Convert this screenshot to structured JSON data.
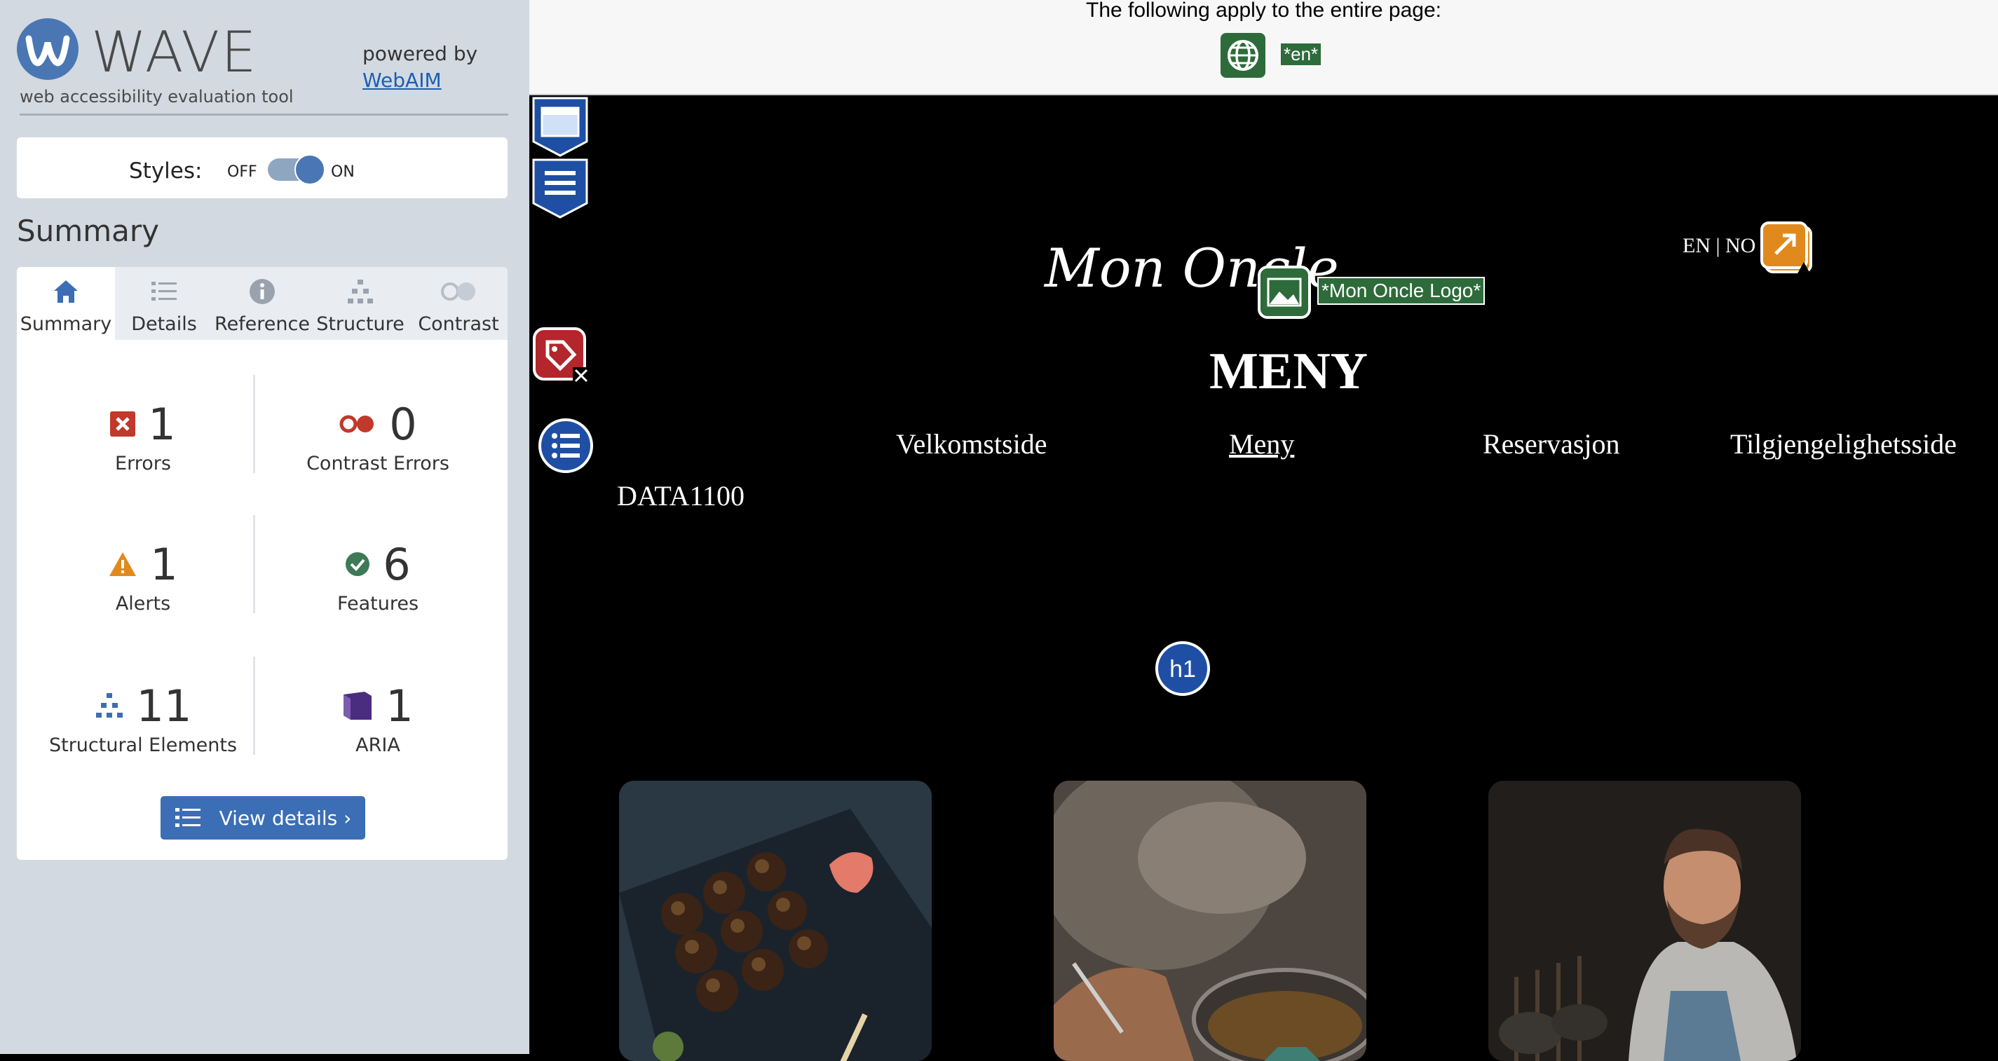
{
  "wave": {
    "logo_text": "WAVE",
    "logo_sub": "web accessibility evaluation tool",
    "powered_by": "powered by",
    "webaim_link": "WebAIM",
    "styles_label": "Styles:",
    "styles_off": "OFF",
    "styles_on": "ON",
    "summary_heading": "Summary",
    "tabs": [
      {
        "label": "Summary",
        "icon": "home-icon"
      },
      {
        "label": "Details",
        "icon": "list-icon"
      },
      {
        "label": "Reference",
        "icon": "info-icon"
      },
      {
        "label": "Structure",
        "icon": "hierarchy-icon"
      },
      {
        "label": "Contrast",
        "icon": "contrast-icon"
      }
    ],
    "stats": {
      "errors": {
        "value": "1",
        "label": "Errors"
      },
      "contrast_errors": {
        "value": "0",
        "label": "Contrast Errors"
      },
      "alerts": {
        "value": "1",
        "label": "Alerts"
      },
      "features": {
        "value": "6",
        "label": "Features"
      },
      "structural": {
        "value": "11",
        "label": "Structural Elements"
      },
      "aria": {
        "value": "1",
        "label": "ARIA"
      }
    },
    "view_details": "View details ›",
    "colors": {
      "error": "#c0392b",
      "alert": "#e08a1e",
      "feature": "#3d7a55",
      "structure": "#3b6eb5",
      "aria": "#5a3b8c"
    }
  },
  "page": {
    "topbar_text": "The following apply to the entire page:",
    "lang_tag": "*en*",
    "brand": "Mon Oncle",
    "logo_alt": "*Mon Oncle Logo*",
    "lang_switch": "EN | NO",
    "nav": [
      "Velkomstside",
      "Meny",
      "Reservasjon",
      "Tilgjengelighetsside",
      "DATA1100"
    ],
    "h1_badge": "h1",
    "h1": "MENY"
  }
}
